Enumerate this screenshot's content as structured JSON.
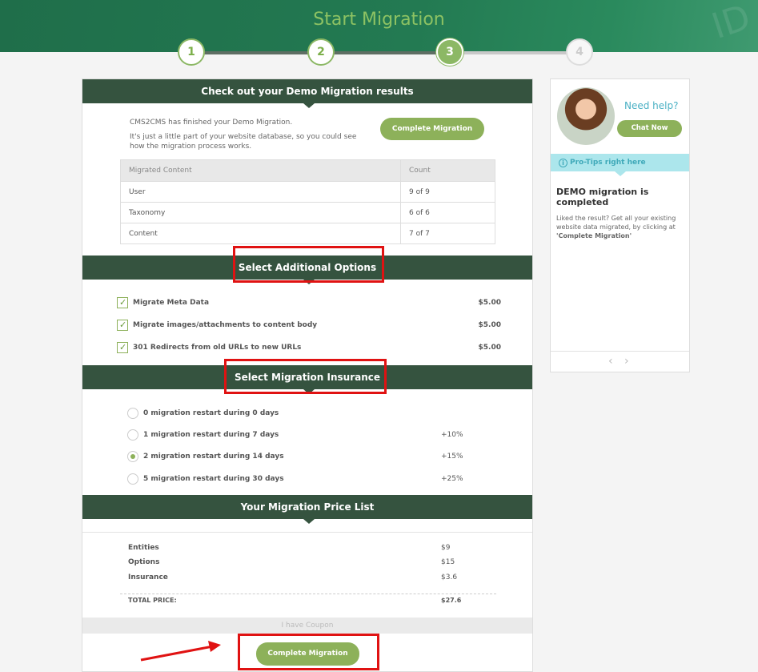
{
  "header": {
    "title": "Start Migration",
    "decoration": "ID"
  },
  "steps": [
    "1",
    "2",
    "3",
    "4"
  ],
  "demo": {
    "title": "Check out your Demo Migration results",
    "message1": "CMS2CMS has finished your Demo Migration.",
    "message2": "It's just a little part of your website database, so you could see how the migration process works.",
    "complete_button": "Complete Migration",
    "table_headers": [
      "Migrated Content",
      "Count"
    ],
    "rows": [
      {
        "content": "User",
        "count": "9 of 9"
      },
      {
        "content": "Taxonomy",
        "count": "6 of 6"
      },
      {
        "content": "Content",
        "count": "7 of 7"
      }
    ]
  },
  "options": {
    "title": "Select Additional Options",
    "items": [
      {
        "label": "Migrate Meta Data",
        "price": "$5.00",
        "checked": true
      },
      {
        "label": "Migrate images/attachments to content body",
        "price": "$5.00",
        "checked": true
      },
      {
        "label": "301 Redirects from old URLs to new URLs",
        "price": "$5.00",
        "checked": true
      }
    ]
  },
  "insurance": {
    "title": "Select Migration Insurance",
    "items": [
      {
        "label": "0 migration restart during 0 days",
        "pct": "",
        "selected": false
      },
      {
        "label": "1 migration restart during 7 days",
        "pct": "+10%",
        "selected": false
      },
      {
        "label": "2 migration restart during 14 days",
        "pct": "+15%",
        "selected": true
      },
      {
        "label": "5 migration restart during 30 days",
        "pct": "+25%",
        "selected": false
      }
    ]
  },
  "prices": {
    "title": "Your Migration Price List",
    "rows": [
      {
        "label": "Entities",
        "value": "$9"
      },
      {
        "label": "Options",
        "value": "$15"
      },
      {
        "label": "Insurance",
        "value": "$3.6"
      }
    ],
    "total_label": "TOTAL PRICE:",
    "total_value": "$27.6"
  },
  "coupon_label": "I have Coupon",
  "final_button": "Complete Migration",
  "sidebar": {
    "need_help": "Need help?",
    "chat_button": "Chat Now",
    "pro_tips": "Pro-Tips right here",
    "tip_title": "DEMO migration is completed",
    "tip_body_1": "Liked the result? Get all your existing website data migrated, by clicking at ",
    "tip_body_bold": "'Complete Migration'",
    "prev": "‹",
    "next": "›"
  },
  "colors": {
    "accent_green": "#8db15a",
    "dark_bar": "#35533f",
    "highlight_red": "#e01212",
    "help_blue": "#4ab0c4"
  }
}
